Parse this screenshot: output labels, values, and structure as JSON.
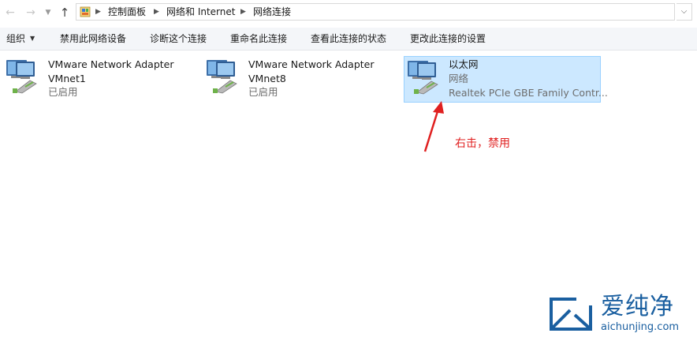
{
  "nav": {
    "back_icon": "arrow-left",
    "forward_icon": "arrow-right",
    "recent_icon": "chevron-down",
    "up_icon": "arrow-up"
  },
  "address": {
    "breadcrumbs": [
      "控制面板",
      "网络和 Internet",
      "网络连接"
    ],
    "dropdown_icon": "chevron-down"
  },
  "commands": {
    "organize": "组织",
    "disable": "禁用此网络设备",
    "diagnose": "诊断这个连接",
    "rename": "重命名此连接",
    "status": "查看此连接的状态",
    "settings": "更改此连接的设置"
  },
  "connections": [
    {
      "name": "VMware Network Adapter",
      "line2": "VMnet1",
      "line3": "已启用",
      "selected": false
    },
    {
      "name": "VMware Network Adapter",
      "line2": "VMnet8",
      "line3": "已启用",
      "selected": false
    },
    {
      "name": "以太网",
      "line2": "网络",
      "line3": "Realtek PCIe GBE Family Contr...",
      "selected": true
    }
  ],
  "annotation": {
    "text": "右击，禁用",
    "color": "#e02020"
  },
  "watermark": {
    "brand": "爱纯净",
    "url": "aichunjing.com",
    "color": "#1a5fa0"
  },
  "colors": {
    "selection_bg": "#cce8ff",
    "selection_border": "#99d1ff",
    "command_bar_bg": "#f4f6f9"
  }
}
